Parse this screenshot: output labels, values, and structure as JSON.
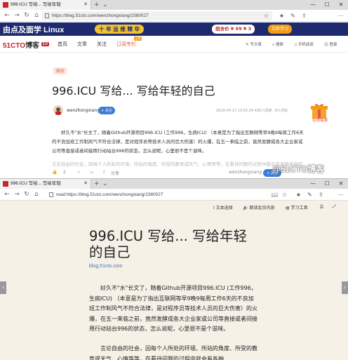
{
  "window1": {
    "tab_title": "996.ICU 写给... 写给年轻",
    "url": "https://blog.51cto.com/wenzhongxiang/2380027",
    "banner": {
      "left_text": "由点及面学 Linux",
      "slogan": "十 年 运 维 精 华",
      "price": "组合价 ¥ 99 ¥ 3",
      "cta": "立即学习"
    },
    "site": {
      "logo_main": "51CTO",
      "logo_blog": "博客",
      "logo_version": "2.0",
      "nav": [
        "首页",
        "文章",
        "关注",
        "订阅专栏"
      ],
      "nav_badge": "上新",
      "right": [
        "写文章",
        "搜索",
        "手机阅读",
        "登录"
      ]
    },
    "article": {
      "tag": "原创",
      "title": "996.ICU 写给... 写给年轻的自己",
      "author": "wenzhongxiang",
      "follow": "关注",
      "meta": "2019-04-17 13:55:24   436人阅读 · 8人评论",
      "body": "好久不\"水\"长文了，随着Github开源项目996.ICU (工作996，生病ICU) （本意是为了指出互联网等早9晚9每周工作6天的不良加班工作制风气不符合法律，是对程序员等技术人员的巨大伤害）的火爆，在五一来临之前，竟然发酵成各大企业家或公司等直接或者间接用行动站台996的状态，怎么说呢，心里很不是个滋味。",
      "faded": "言论自由的社会，因每个人所处的环境、所站的角度、所受的教育或天气、心情等等，在看待问题的过程中都会有各种各样的观点，",
      "bottom_bar": [
        "2",
        "分享"
      ],
      "bottom_author": "wenzhongxiang",
      "bottom_follow": "关注"
    },
    "gift_text": "在线客服"
  },
  "window2": {
    "tab_title": "996.ICU 写给... 写给年轻",
    "url": "read:https://blog.51cto.com/wenzhongxiang/2380027",
    "tools": [
      "文本选择",
      "朗读此页内容",
      "学习工具"
    ],
    "title": "996.ICU 写给... 写给年轻的自己",
    "source": "blog.51cto.com",
    "para1": "好久不\"水\"长文了，随着Github开源项目996.ICU (工作996，生病ICU) （本意是为了指出互联网等早9晚9每周工作6天的不良加班工作制风气不符合法律，是对程序员等技术人员的巨大伤害）的火爆，在五一来临之前，竟然发酵成各大企业家或公司等直接或者间接用行动站台996的状态，怎么说呢，心里很不是个滋味。",
    "para2": "言论自由的社会，因每个人所处的环境、所站的角度、所受的教育或天气、心情等等，在看待问题的过程中就会有各种"
  },
  "watermark": "@51CTO博客",
  "window_controls": [
    "—",
    "☐",
    "✕"
  ],
  "colors": {
    "brand_red": "#c2272d",
    "link_blue": "#3f73b5",
    "reading_bg": "#f6f1e7",
    "banner_bg": "#1e2a6e"
  }
}
